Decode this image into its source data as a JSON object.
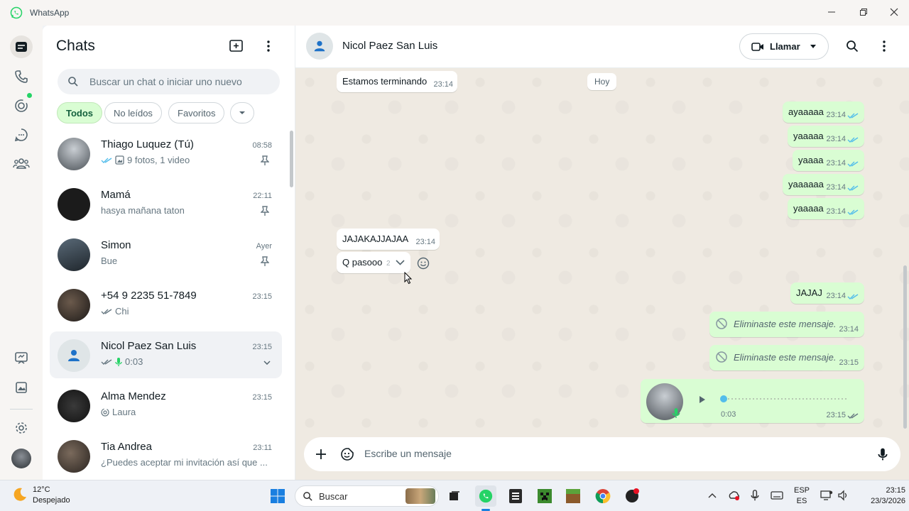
{
  "window": {
    "title": "WhatsApp"
  },
  "chatlist": {
    "title": "Chats",
    "search_placeholder": "Buscar un chat o iniciar uno nuevo",
    "filters": [
      "Todos",
      "No leídos",
      "Favoritos"
    ],
    "chats": [
      {
        "name": "Thiago Luquez (Tú)",
        "time": "08:58",
        "preview": "9 fotos, 1 video",
        "pinned": true
      },
      {
        "name": "Mamá",
        "time": "22:11",
        "preview": "hasya mañana taton",
        "pinned": true
      },
      {
        "name": "Simon",
        "time": "Ayer",
        "preview": "Bue",
        "pinned": true
      },
      {
        "name": "+54 9 2235 51-7849",
        "time": "23:15",
        "preview": "Chi",
        "pinned": false
      },
      {
        "name": "Nicol Paez San Luis",
        "time": "23:15",
        "preview": "0:03",
        "pinned": false
      },
      {
        "name": "Alma Mendez",
        "time": "23:15",
        "preview": "Laura",
        "pinned": false
      },
      {
        "name": "Tia Andrea",
        "time": "23:11",
        "preview": "¿Puedes aceptar mi invitación así que ...",
        "pinned": false
      }
    ]
  },
  "conversation": {
    "contact_name": "Nicol Paez San Luis",
    "call_label": "Llamar",
    "day_label": "Hoy",
    "messages": [
      {
        "dir": "in",
        "text": "Estamos terminando",
        "time": "23:14"
      },
      {
        "dir": "out",
        "text": "ayaaaaa",
        "time": "23:14"
      },
      {
        "dir": "out",
        "text": "yaaaaa",
        "time": "23:14"
      },
      {
        "dir": "out",
        "text": "yaaaa",
        "time": "23:14"
      },
      {
        "dir": "out",
        "text": "yaaaaaa",
        "time": "23:14"
      },
      {
        "dir": "out",
        "text": "yaaaaa",
        "time": "23:14"
      },
      {
        "dir": "in",
        "text": "JAJAKAJJAJAA",
        "time": "23:14"
      },
      {
        "dir": "in",
        "text": "Q pasooo",
        "time": "2"
      },
      {
        "dir": "out",
        "text": "JAJAJ",
        "time": "23:14"
      },
      {
        "dir": "out",
        "text": "Eliminaste este mensaje.",
        "time": "23:14"
      },
      {
        "dir": "out",
        "text": "Eliminaste este mensaje.",
        "time": "23:15"
      }
    ],
    "voice_note": {
      "duration": "0:03",
      "time": "23:15",
      "progress": 0
    },
    "composer_placeholder": "Escribe un mensaje"
  },
  "taskbar": {
    "temperature": "12°C",
    "condition": "Despejado",
    "search_label": "Buscar",
    "lang_top": "ESP",
    "lang_bottom": "ES",
    "clock_time": "23:15",
    "clock_date": "23/3/2026"
  },
  "colors": {
    "accent": "#25d366",
    "outgoing_bubble": "#d9fdd3",
    "tick_blue": "#53bdeb"
  }
}
